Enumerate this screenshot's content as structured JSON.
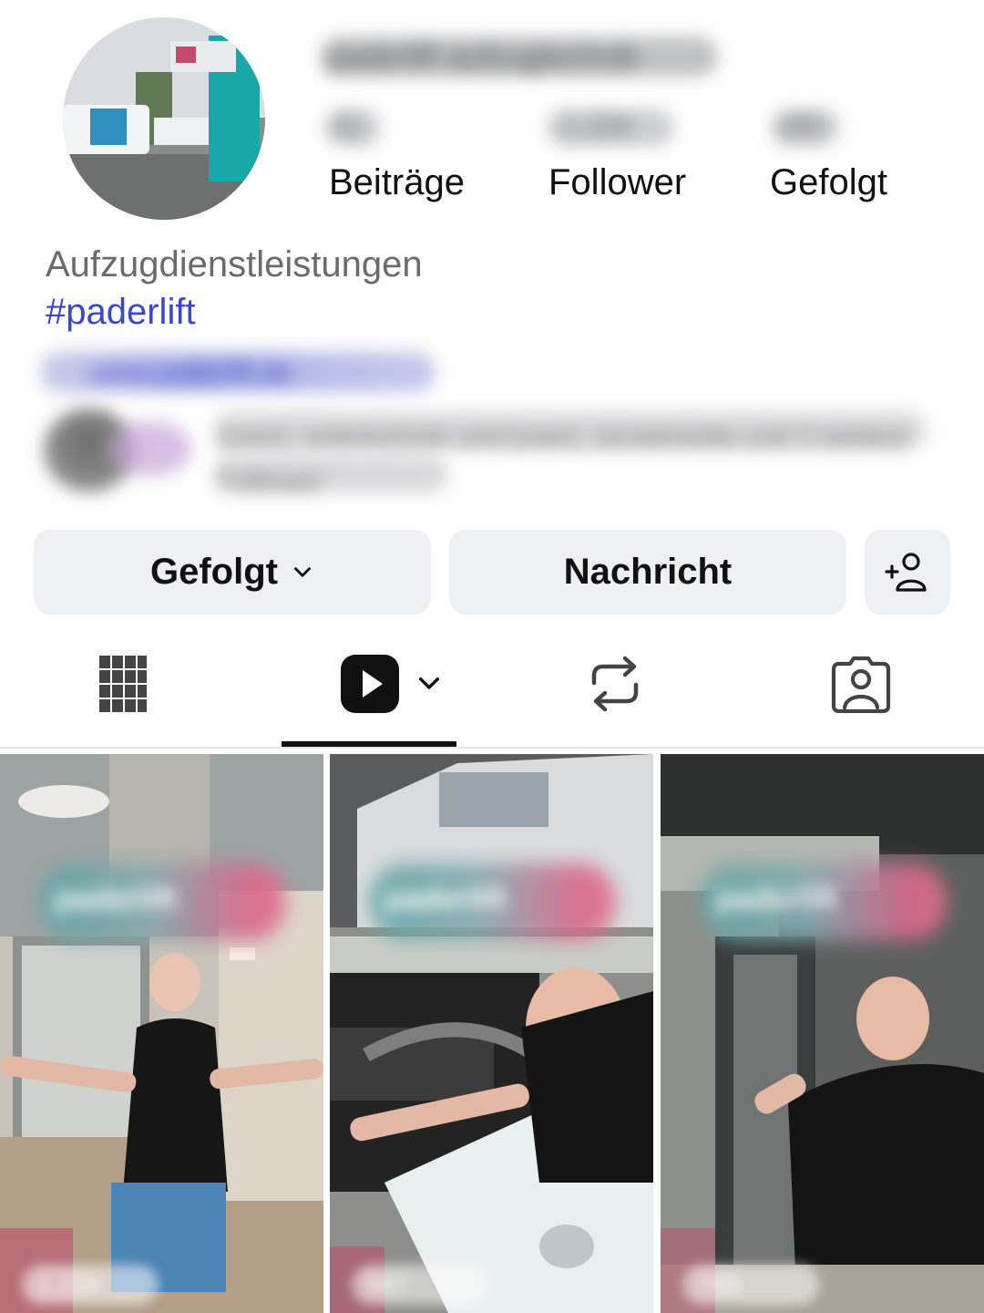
{
  "profile": {
    "handle": "paderlift aufzugtechnik",
    "stats": [
      {
        "value": "41",
        "label": "Beiträge"
      },
      {
        "value": "1.234",
        "label": "Follower"
      },
      {
        "value": "180",
        "label": "Gefolgt"
      }
    ],
    "category": "Aufzugdienstleistungen",
    "hashtag": "#paderlift",
    "link": "www.paderlift.de",
    "mutual_followers": "[user], solartechnik und [user], socialmedia und 3 weitere Follower"
  },
  "actions": {
    "follow_label": "Gefolgt",
    "message_label": "Nachricht",
    "add_user_icon": "add-user-icon"
  },
  "tabs": [
    {
      "name": "grid",
      "icon": "grid-icon"
    },
    {
      "name": "reels",
      "icon": "reels-play-icon",
      "active": true
    },
    {
      "name": "reposts",
      "icon": "repost-icon"
    },
    {
      "name": "tagged",
      "icon": "tagged-person-icon"
    }
  ],
  "reels": [
    {
      "overlay_text": "paderlift",
      "views": "1.234"
    },
    {
      "overlay_text": "paderlift",
      "views": "987"
    },
    {
      "overlay_text": "paderlift",
      "views": "765"
    }
  ],
  "colors": {
    "hashtag": "#3b47c9",
    "button_bg": "#eff0f4",
    "brand_teal": "#1aa7a9"
  }
}
